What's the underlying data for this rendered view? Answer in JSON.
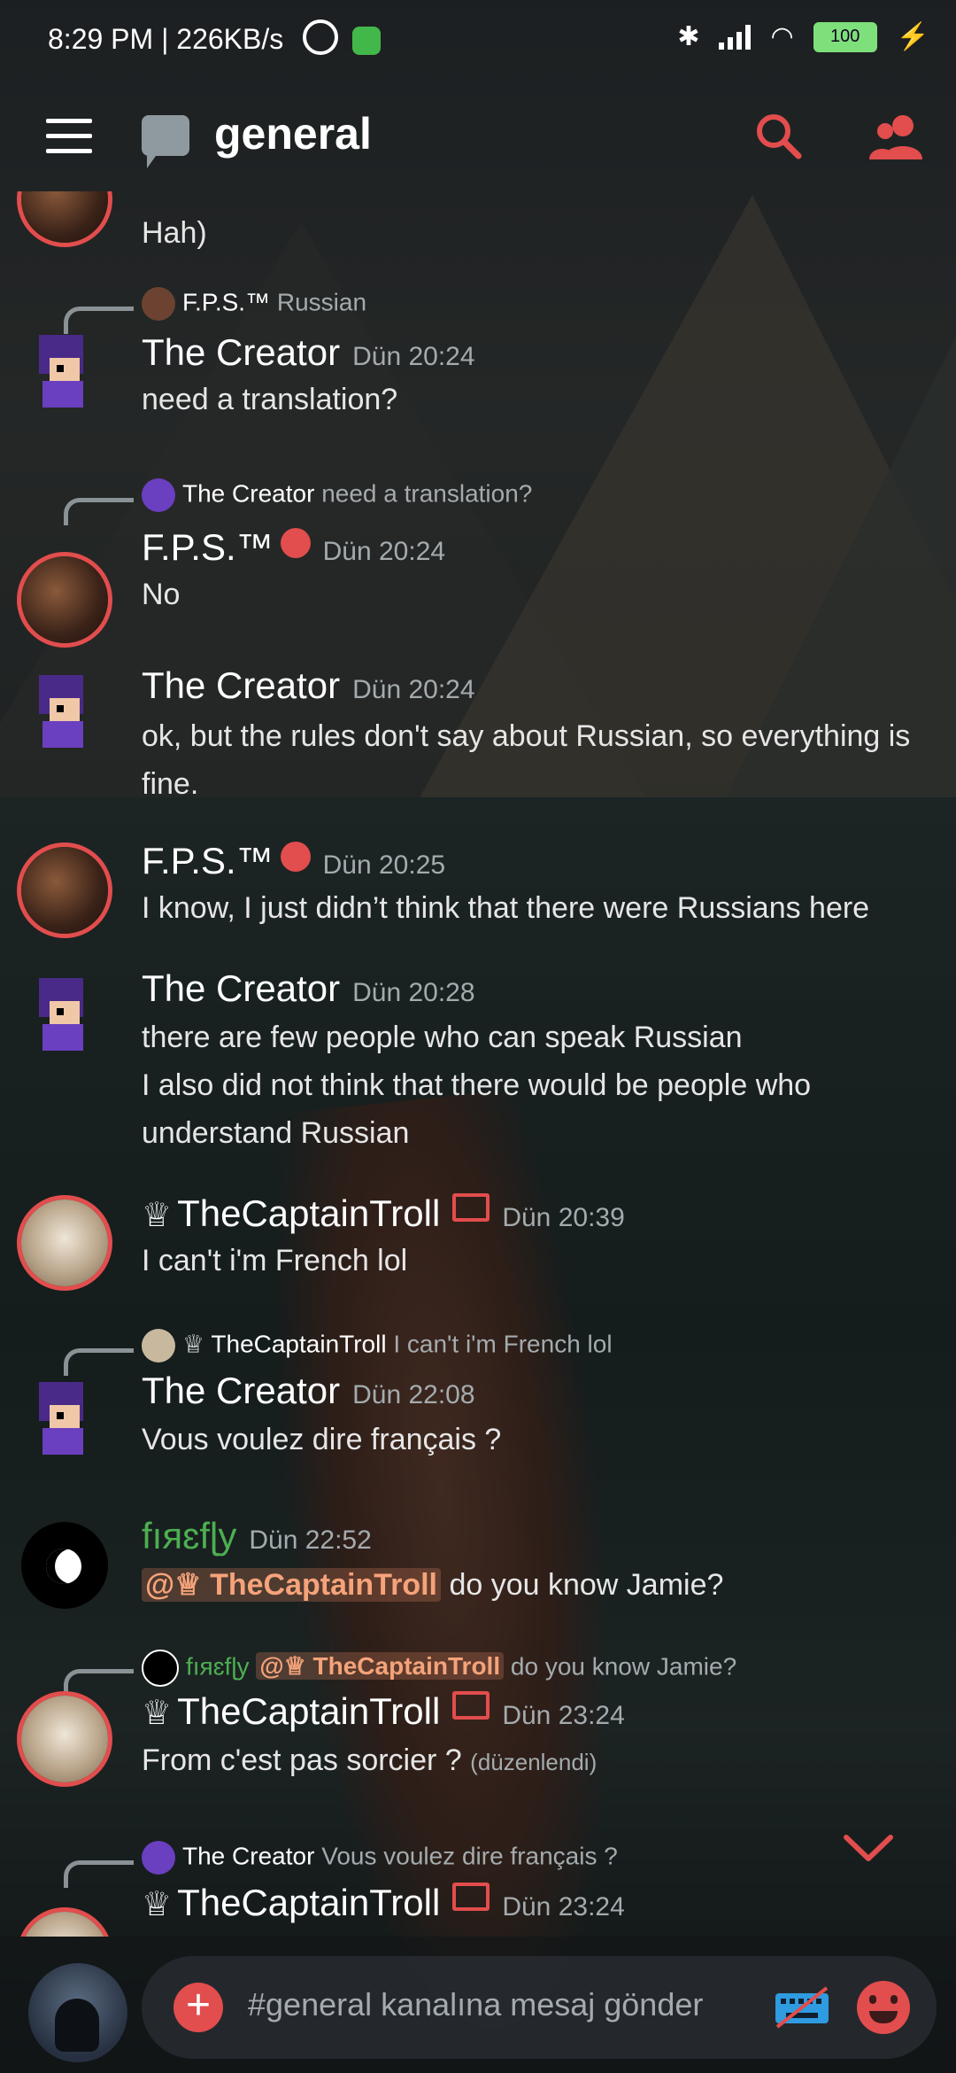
{
  "status_bar": {
    "time_speed": "8:29 PM | 226KB/s",
    "battery": "100"
  },
  "header": {
    "channel": "general"
  },
  "messages": [
    {
      "kind": "continuation",
      "text": "Hah)"
    },
    {
      "reply": {
        "author": "F.P.S.™",
        "snippet": "Russian"
      },
      "author": "The Creator",
      "time": "Dün 20:24",
      "text": "need a translation?"
    },
    {
      "reply": {
        "author": "The Creator",
        "snippet": "need a translation?"
      },
      "author": "F.P.S.™",
      "time": "Dün 20:24",
      "text": "No"
    },
    {
      "author": "The Creator",
      "time": "Dün 20:24",
      "text": "ok, but the rules don't say about Russian, so everything is fine."
    },
    {
      "author": "F.P.S.™",
      "time": "Dün 20:25",
      "text": "I know, I just didn’t think that there were Russians here"
    },
    {
      "author": "The Creator",
      "time": "Dün 20:28",
      "text": "there are few people who can speak Russian",
      "text2": "I also did not think that there would be people who understand Russian"
    },
    {
      "author": "TheCaptainTroll",
      "crown": "♕",
      "time": "Dün 20:39",
      "text": "I can't i'm French lol"
    },
    {
      "reply": {
        "author": "TheCaptainTroll",
        "snippet": "I can't i'm French lol"
      },
      "author": "The Creator",
      "time": "Dün 22:08",
      "text": "Vous voulez dire français ?"
    },
    {
      "author": "fıяɛfɭy",
      "time": "Dün 22:52",
      "mention": "@♕ TheCaptainTroll",
      "text": "do you know Jamie?"
    },
    {
      "reply": {
        "author": "fıяɛfɭy",
        "mention": "@♕ TheCaptainTroll",
        "snippet": "do you know Jamie?"
      },
      "author": "TheCaptainTroll",
      "time": "Dün 23:24",
      "text": "From c'est pas sorcier ?",
      "edited": "(düzenlendi)"
    },
    {
      "reply": {
        "author": "The Creator",
        "snippet": "Vous voulez dire français ?"
      },
      "author": "TheCaptainTroll",
      "time": "Dün 23:24"
    }
  ],
  "composer": {
    "placeholder": "#general kanalına mesaj gönder",
    "plus": "+"
  },
  "colors": {
    "accent": "#e24d4d",
    "muted": "#a4abae",
    "firefly": "#4caf50",
    "mention": "#f5a37a"
  },
  "icons": [
    "menu-icon",
    "chat-bubble-icon",
    "search-icon",
    "members-icon",
    "globe-icon",
    "monitor-icon",
    "crown-icon",
    "chevron-down-icon",
    "plus-icon",
    "keyboard-icon",
    "emoji-icon"
  ]
}
